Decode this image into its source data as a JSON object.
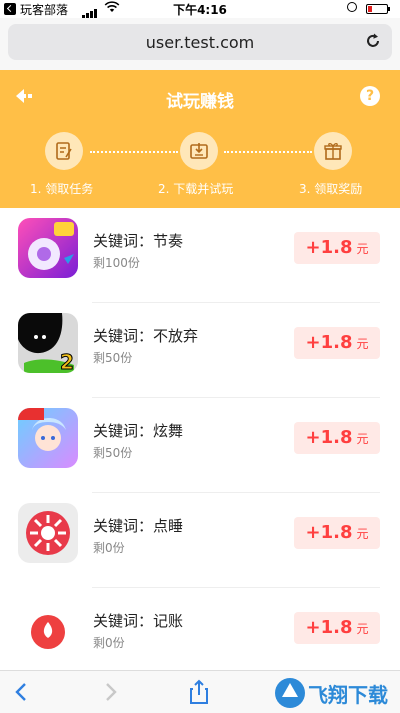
{
  "status_bar": {
    "app_name": "玩客部落",
    "time": "下午4:16",
    "battery_percent": 15
  },
  "browser": {
    "url": "user.test.com"
  },
  "header": {
    "title": "试玩赚钱",
    "help": "?",
    "steps": [
      {
        "label": "1. 领取任务",
        "icon": "task-icon"
      },
      {
        "label": "2. 下载并试玩",
        "icon": "download-icon"
      },
      {
        "label": "3. 领取奖励",
        "icon": "gift-icon"
      }
    ],
    "color": "#ffbf47"
  },
  "tasks": [
    {
      "keyword": "关键词：节奏",
      "remaining": "剩100份",
      "amount": "+1.8",
      "unit": "元",
      "icon": "rhythm-game-icon"
    },
    {
      "keyword": "关键词：不放弃",
      "remaining": "剩50份",
      "amount": "+1.8",
      "unit": "元",
      "icon": "black-blob-game-icon"
    },
    {
      "keyword": "关键词：炫舞",
      "remaining": "剩50份",
      "amount": "+1.8",
      "unit": "元",
      "icon": "dance-game-icon"
    },
    {
      "keyword": "关键词：点睡",
      "remaining": "剩0份",
      "amount": "+1.8",
      "unit": "元",
      "icon": "sleep-app-icon"
    },
    {
      "keyword": "关键词：记账",
      "remaining": "剩0份",
      "amount": "+1.8",
      "unit": "元",
      "icon": "accounting-app-icon"
    }
  ],
  "toolbar": {
    "items": [
      "back-icon",
      "forward-icon",
      "share-icon"
    ]
  },
  "watermark": {
    "text": "飞翔下载"
  },
  "colors": {
    "reward_text": "#ff3f3f",
    "reward_bg": "#ffe9e6"
  }
}
